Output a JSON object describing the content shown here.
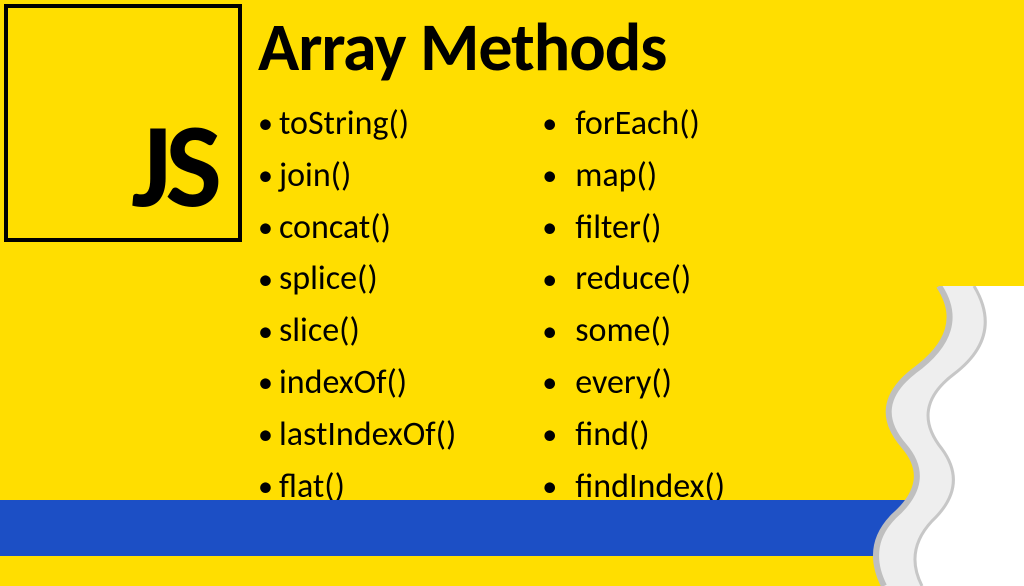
{
  "badge": {
    "label": "JS"
  },
  "title": "Array Methods",
  "columns": {
    "left": [
      "toString()",
      "join()",
      "concat()",
      "splice()",
      "slice()",
      "indexOf()",
      "lastIndexOf()",
      "flat()"
    ],
    "right": [
      "forEach()",
      "map()",
      "filter()",
      "reduce()",
      "some()",
      "every()",
      "find()",
      "findIndex()"
    ]
  }
}
